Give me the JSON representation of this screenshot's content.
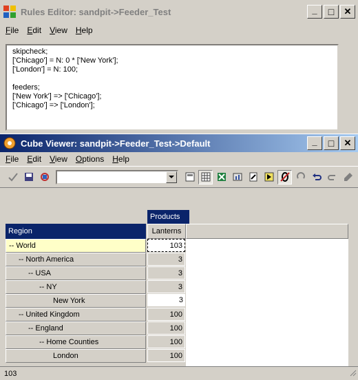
{
  "rules_editor": {
    "title": "Rules Editor:  sandpit->Feeder_Test",
    "menu": [
      "File",
      "Edit",
      "View",
      "Help"
    ],
    "code_lines": [
      "skipcheck;",
      "['Chicago'] = N: 0 * ['New York'];",
      "['London'] = N: 100;",
      "",
      "feeders;",
      "['New York'] => ['Chicago'];",
      "['Chicago'] => ['London'];"
    ]
  },
  "cube_viewer": {
    "title": "Cube Viewer: sandpit->Feeder_Test->Default",
    "menu": [
      "File",
      "Edit",
      "View",
      "Options",
      "Help"
    ],
    "subset_combo_value": "",
    "column_dimension": "Products",
    "column_header": "Lanterns",
    "row_dimension": "Region",
    "rows": [
      {
        "label": "-- World",
        "value": "103"
      },
      {
        "label": "-- North America",
        "value": "3"
      },
      {
        "label": "-- USA",
        "value": "3"
      },
      {
        "label": "-- NY",
        "value": "3"
      },
      {
        "label": "New York",
        "value": "3"
      },
      {
        "label": "-- United Kingdom",
        "value": "100"
      },
      {
        "label": "-- England",
        "value": "100"
      },
      {
        "label": "-- Home Counties",
        "value": "100"
      },
      {
        "label": "London",
        "value": "100"
      }
    ],
    "status": "103"
  },
  "window_controls": {
    "minimize": "_",
    "maximize": "□",
    "close": "✕"
  },
  "colors": {
    "active_title": "#0a246a",
    "selected_row": "#ffffc8",
    "face": "#d4d0c8"
  }
}
